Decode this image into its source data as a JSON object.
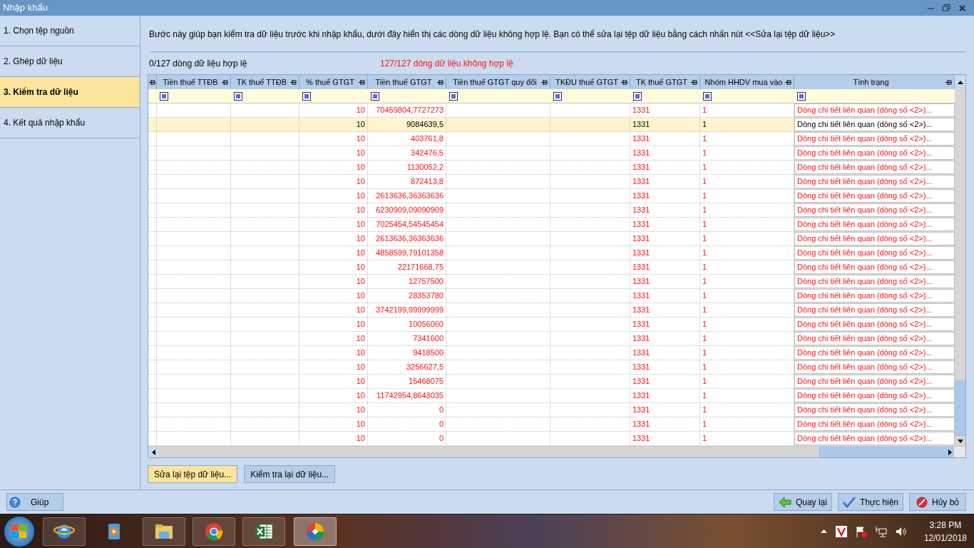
{
  "window": {
    "title": "Nhập khẩu"
  },
  "steps": [
    {
      "label": "1. Chọn tệp nguồn",
      "selected": false
    },
    {
      "label": "2. Ghép dữ liệu",
      "selected": false
    },
    {
      "label": "3. Kiểm tra dữ liệu",
      "selected": true
    },
    {
      "label": "4. Kết quả nhập khẩu",
      "selected": false
    }
  ],
  "description": "Bước này giúp bạn kiểm tra dữ liệu trước khi nhập khẩu, dưới đây hiển thị các dòng dữ liệu không hợp lệ. Bạn có thể sửa lại tệp dữ liệu bằng cách nhấn nút <<Sửa lại tệp dữ liệu>>",
  "valid_count": "0/127 dòng dữ liệu hợp lệ",
  "invalid_count": "127/127 dòng dữ liệu không hợp lệ",
  "table": {
    "columns": [
      "Tiền thuế TTĐB",
      "TK thuế TTĐB",
      "% thuế GTGT",
      "Tiền thuế GTGT",
      "Tiền thuế GTGT quy đổi",
      "TKĐU thuế GTGT",
      "TK thuế GTGT",
      "Nhóm HHDV mua vào",
      "Tình trạng"
    ],
    "rows": [
      {
        "selected": false,
        "cells": [
          "",
          "",
          "10",
          "70459804,7727273",
          "",
          "",
          "1331",
          "1",
          "Dòng chi tiết liên quan (dòng số <2>)..."
        ]
      },
      {
        "selected": true,
        "cells": [
          "",
          "",
          "10",
          "9084639,5",
          "",
          "",
          "1331",
          "1",
          "Dòng chi tiết liên quan (dòng số <2>)..."
        ]
      },
      {
        "selected": false,
        "cells": [
          "",
          "",
          "10",
          "403761,8",
          "",
          "",
          "1331",
          "1",
          "Dòng chi tiết liên quan (dòng số <2>)..."
        ]
      },
      {
        "selected": false,
        "cells": [
          "",
          "",
          "10",
          "342476,5",
          "",
          "",
          "1331",
          "1",
          "Dòng chi tiết liên quan (dòng số <2>)..."
        ]
      },
      {
        "selected": false,
        "cells": [
          "",
          "",
          "10",
          "1130052,2",
          "",
          "",
          "1331",
          "1",
          "Dòng chi tiết liên quan (dòng số <2>)..."
        ]
      },
      {
        "selected": false,
        "cells": [
          "",
          "",
          "10",
          "872413,8",
          "",
          "",
          "1331",
          "1",
          "Dòng chi tiết liên quan (dòng số <2>)..."
        ]
      },
      {
        "selected": false,
        "cells": [
          "",
          "",
          "10",
          "2613636,36363636",
          "",
          "",
          "1331",
          "1",
          "Dòng chi tiết liên quan (dòng số <2>)..."
        ]
      },
      {
        "selected": false,
        "cells": [
          "",
          "",
          "10",
          "6230909,09090909",
          "",
          "",
          "1331",
          "1",
          "Dòng chi tiết liên quan (dòng số <2>)..."
        ]
      },
      {
        "selected": false,
        "cells": [
          "",
          "",
          "10",
          "7025454,54545454",
          "",
          "",
          "1331",
          "1",
          "Dòng chi tiết liên quan (dòng số <2>)..."
        ]
      },
      {
        "selected": false,
        "cells": [
          "",
          "",
          "10",
          "2613636,36363636",
          "",
          "",
          "1331",
          "1",
          "Dòng chi tiết liên quan (dòng số <2>)..."
        ]
      },
      {
        "selected": false,
        "cells": [
          "",
          "",
          "10",
          "4858599,79101358",
          "",
          "",
          "1331",
          "1",
          "Dòng chi tiết liên quan (dòng số <2>)..."
        ]
      },
      {
        "selected": false,
        "cells": [
          "",
          "",
          "10",
          "22171668,75",
          "",
          "",
          "1331",
          "1",
          "Dòng chi tiết liên quan (dòng số <2>)..."
        ]
      },
      {
        "selected": false,
        "cells": [
          "",
          "",
          "10",
          "12757500",
          "",
          "",
          "1331",
          "1",
          "Dòng chi tiết liên quan (dòng số <2>)..."
        ]
      },
      {
        "selected": false,
        "cells": [
          "",
          "",
          "10",
          "28353780",
          "",
          "",
          "1331",
          "1",
          "Dòng chi tiết liên quan (dòng số <2>)..."
        ]
      },
      {
        "selected": false,
        "cells": [
          "",
          "",
          "10",
          "3742199,99999999",
          "",
          "",
          "1331",
          "1",
          "Dòng chi tiết liên quan (dòng số <2>)..."
        ]
      },
      {
        "selected": false,
        "cells": [
          "",
          "",
          "10",
          "10056060",
          "",
          "",
          "1331",
          "1",
          "Dòng chi tiết liên quan (dòng số <2>)..."
        ]
      },
      {
        "selected": false,
        "cells": [
          "",
          "",
          "10",
          "7341600",
          "",
          "",
          "1331",
          "1",
          "Dòng chi tiết liên quan (dòng số <2>)..."
        ]
      },
      {
        "selected": false,
        "cells": [
          "",
          "",
          "10",
          "9418500",
          "",
          "",
          "1331",
          "1",
          "Dòng chi tiết liên quan (dòng số <2>)..."
        ]
      },
      {
        "selected": false,
        "cells": [
          "",
          "",
          "10",
          "3256627,5",
          "",
          "",
          "1331",
          "1",
          "Dòng chi tiết liên quan (dòng số <2>)..."
        ]
      },
      {
        "selected": false,
        "cells": [
          "",
          "",
          "10",
          "15468075",
          "",
          "",
          "1331",
          "1",
          "Dòng chi tiết liên quan (dòng số <2>)..."
        ]
      },
      {
        "selected": false,
        "cells": [
          "",
          "",
          "10",
          "11742954,8643035",
          "",
          "",
          "1331",
          "1",
          "Dòng chi tiết liên quan (dòng số <2>)..."
        ]
      },
      {
        "selected": false,
        "cells": [
          "",
          "",
          "10",
          "0",
          "",
          "",
          "1331",
          "1",
          "Dòng chi tiết liên quan (dòng số <2>)..."
        ]
      },
      {
        "selected": false,
        "cells": [
          "",
          "",
          "10",
          "0",
          "",
          "",
          "1331",
          "1",
          "Dòng chi tiết liên quan (dòng số <2>)..."
        ]
      },
      {
        "selected": false,
        "cells": [
          "",
          "",
          "10",
          "0",
          "",
          "",
          "1331",
          "1",
          "Dòng chi tiết liên quan (dòng số <2>)..."
        ]
      }
    ]
  },
  "actions": [
    "Sửa lại tệp dữ liệu...",
    "Kiểm tra lại dữ liệu..."
  ],
  "help_button": "Giúp",
  "nav_buttons": [
    {
      "kind": "back",
      "label": "Quay lại"
    },
    {
      "kind": "ok",
      "label": "Thực hiện"
    },
    {
      "kind": "cancel",
      "label": "Hủy bỏ"
    }
  ],
  "taskbar": {
    "time": "3:28 PM",
    "date": "12/01/2018"
  }
}
